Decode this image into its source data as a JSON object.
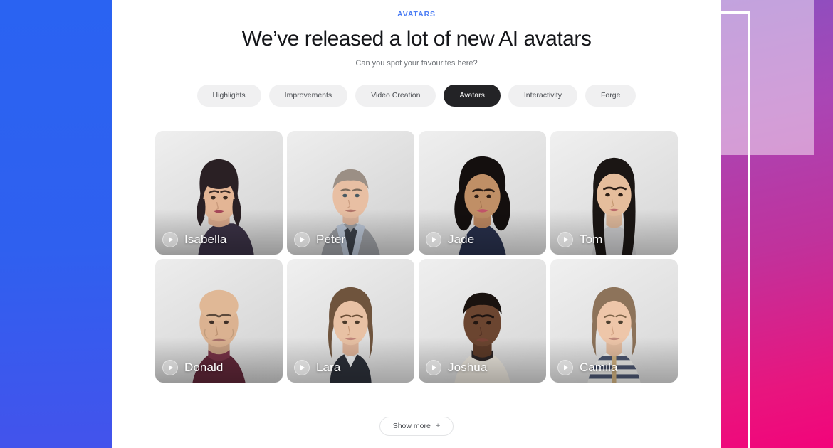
{
  "header": {
    "eyebrow": "AVATARS",
    "headline": "We’ve released a lot of new AI avatars",
    "subhead": "Can you spot your favourites here?"
  },
  "tabs": [
    {
      "label": "Highlights",
      "active": false
    },
    {
      "label": "Improvements",
      "active": false
    },
    {
      "label": "Video Creation",
      "active": false
    },
    {
      "label": "Avatars",
      "active": true
    },
    {
      "label": "Interactivity",
      "active": false
    },
    {
      "label": "Forge",
      "active": false
    }
  ],
  "avatars": [
    {
      "name": "Isabella",
      "play_icon": "play-icon"
    },
    {
      "name": "Peter",
      "play_icon": "play-icon"
    },
    {
      "name": "Jade",
      "play_icon": "play-icon"
    },
    {
      "name": "Tom",
      "play_icon": "play-icon"
    },
    {
      "name": "Donald",
      "play_icon": "play-icon"
    },
    {
      "name": "Lara",
      "play_icon": "play-icon"
    },
    {
      "name": "Joshua",
      "play_icon": "play-icon"
    },
    {
      "name": "Camila",
      "play_icon": "play-icon"
    }
  ],
  "footer": {
    "show_more_label": "Show more",
    "show_more_plus": "+"
  },
  "colors": {
    "eyebrow_blue": "#4a7cf4",
    "tab_active_bg": "#232326",
    "tab_bg": "#f0f0f1",
    "left_gradient_start": "#2a63f2",
    "left_gradient_end": "#4353ec",
    "right_gradient_start": "#8b4fc0",
    "right_gradient_end": "#f2047a"
  }
}
